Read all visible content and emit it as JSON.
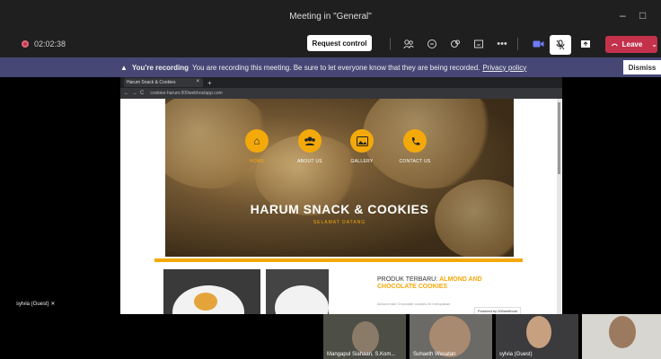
{
  "window": {
    "title": "Meeting in \"General\"",
    "minimize": "–",
    "maximize": "□"
  },
  "toolbar": {
    "timer": "02:02:38",
    "request_control": "Request control",
    "leave": "Leave"
  },
  "banner": {
    "title": "You're recording",
    "message": "You are recording this meeting. Be sure to let everyone know that they are being recorded.",
    "link": "Privacy policy",
    "dismiss": "Dismiss"
  },
  "browser": {
    "tab_title": "Harum Snack & Cookies",
    "url": "cookies-harum.000webhostapp.com"
  },
  "site": {
    "nav": [
      {
        "label": "HOME",
        "icon": "home-icon"
      },
      {
        "label": "ABOUT US",
        "icon": "users-icon"
      },
      {
        "label": "GALLERY",
        "icon": "image-icon"
      },
      {
        "label": "CONTACT US",
        "icon": "phone-icon"
      }
    ],
    "title": "HARUM SNACK & COOKIES",
    "subtitle": "SELAMAT DATANG",
    "product_prefix": "PRODUK TERBARU:",
    "product_highlight": "ALMOND AND CHOCOLATE COOKIES",
    "product_desc": "Almond dan Chocolate cookies ini merupakan",
    "powered": "Powered by 000webhost"
  },
  "presenter": {
    "name": "sylvia (Guest)"
  },
  "participants": [
    {
      "name": "Mangapul Siahaan, S.Kom..."
    },
    {
      "name": "Suhaeth Wasatan"
    },
    {
      "name": "sylvia (Guest)"
    }
  ],
  "colors": {
    "accent": "#f4a90a",
    "leave": "#c4314b",
    "banner": "#464775"
  }
}
